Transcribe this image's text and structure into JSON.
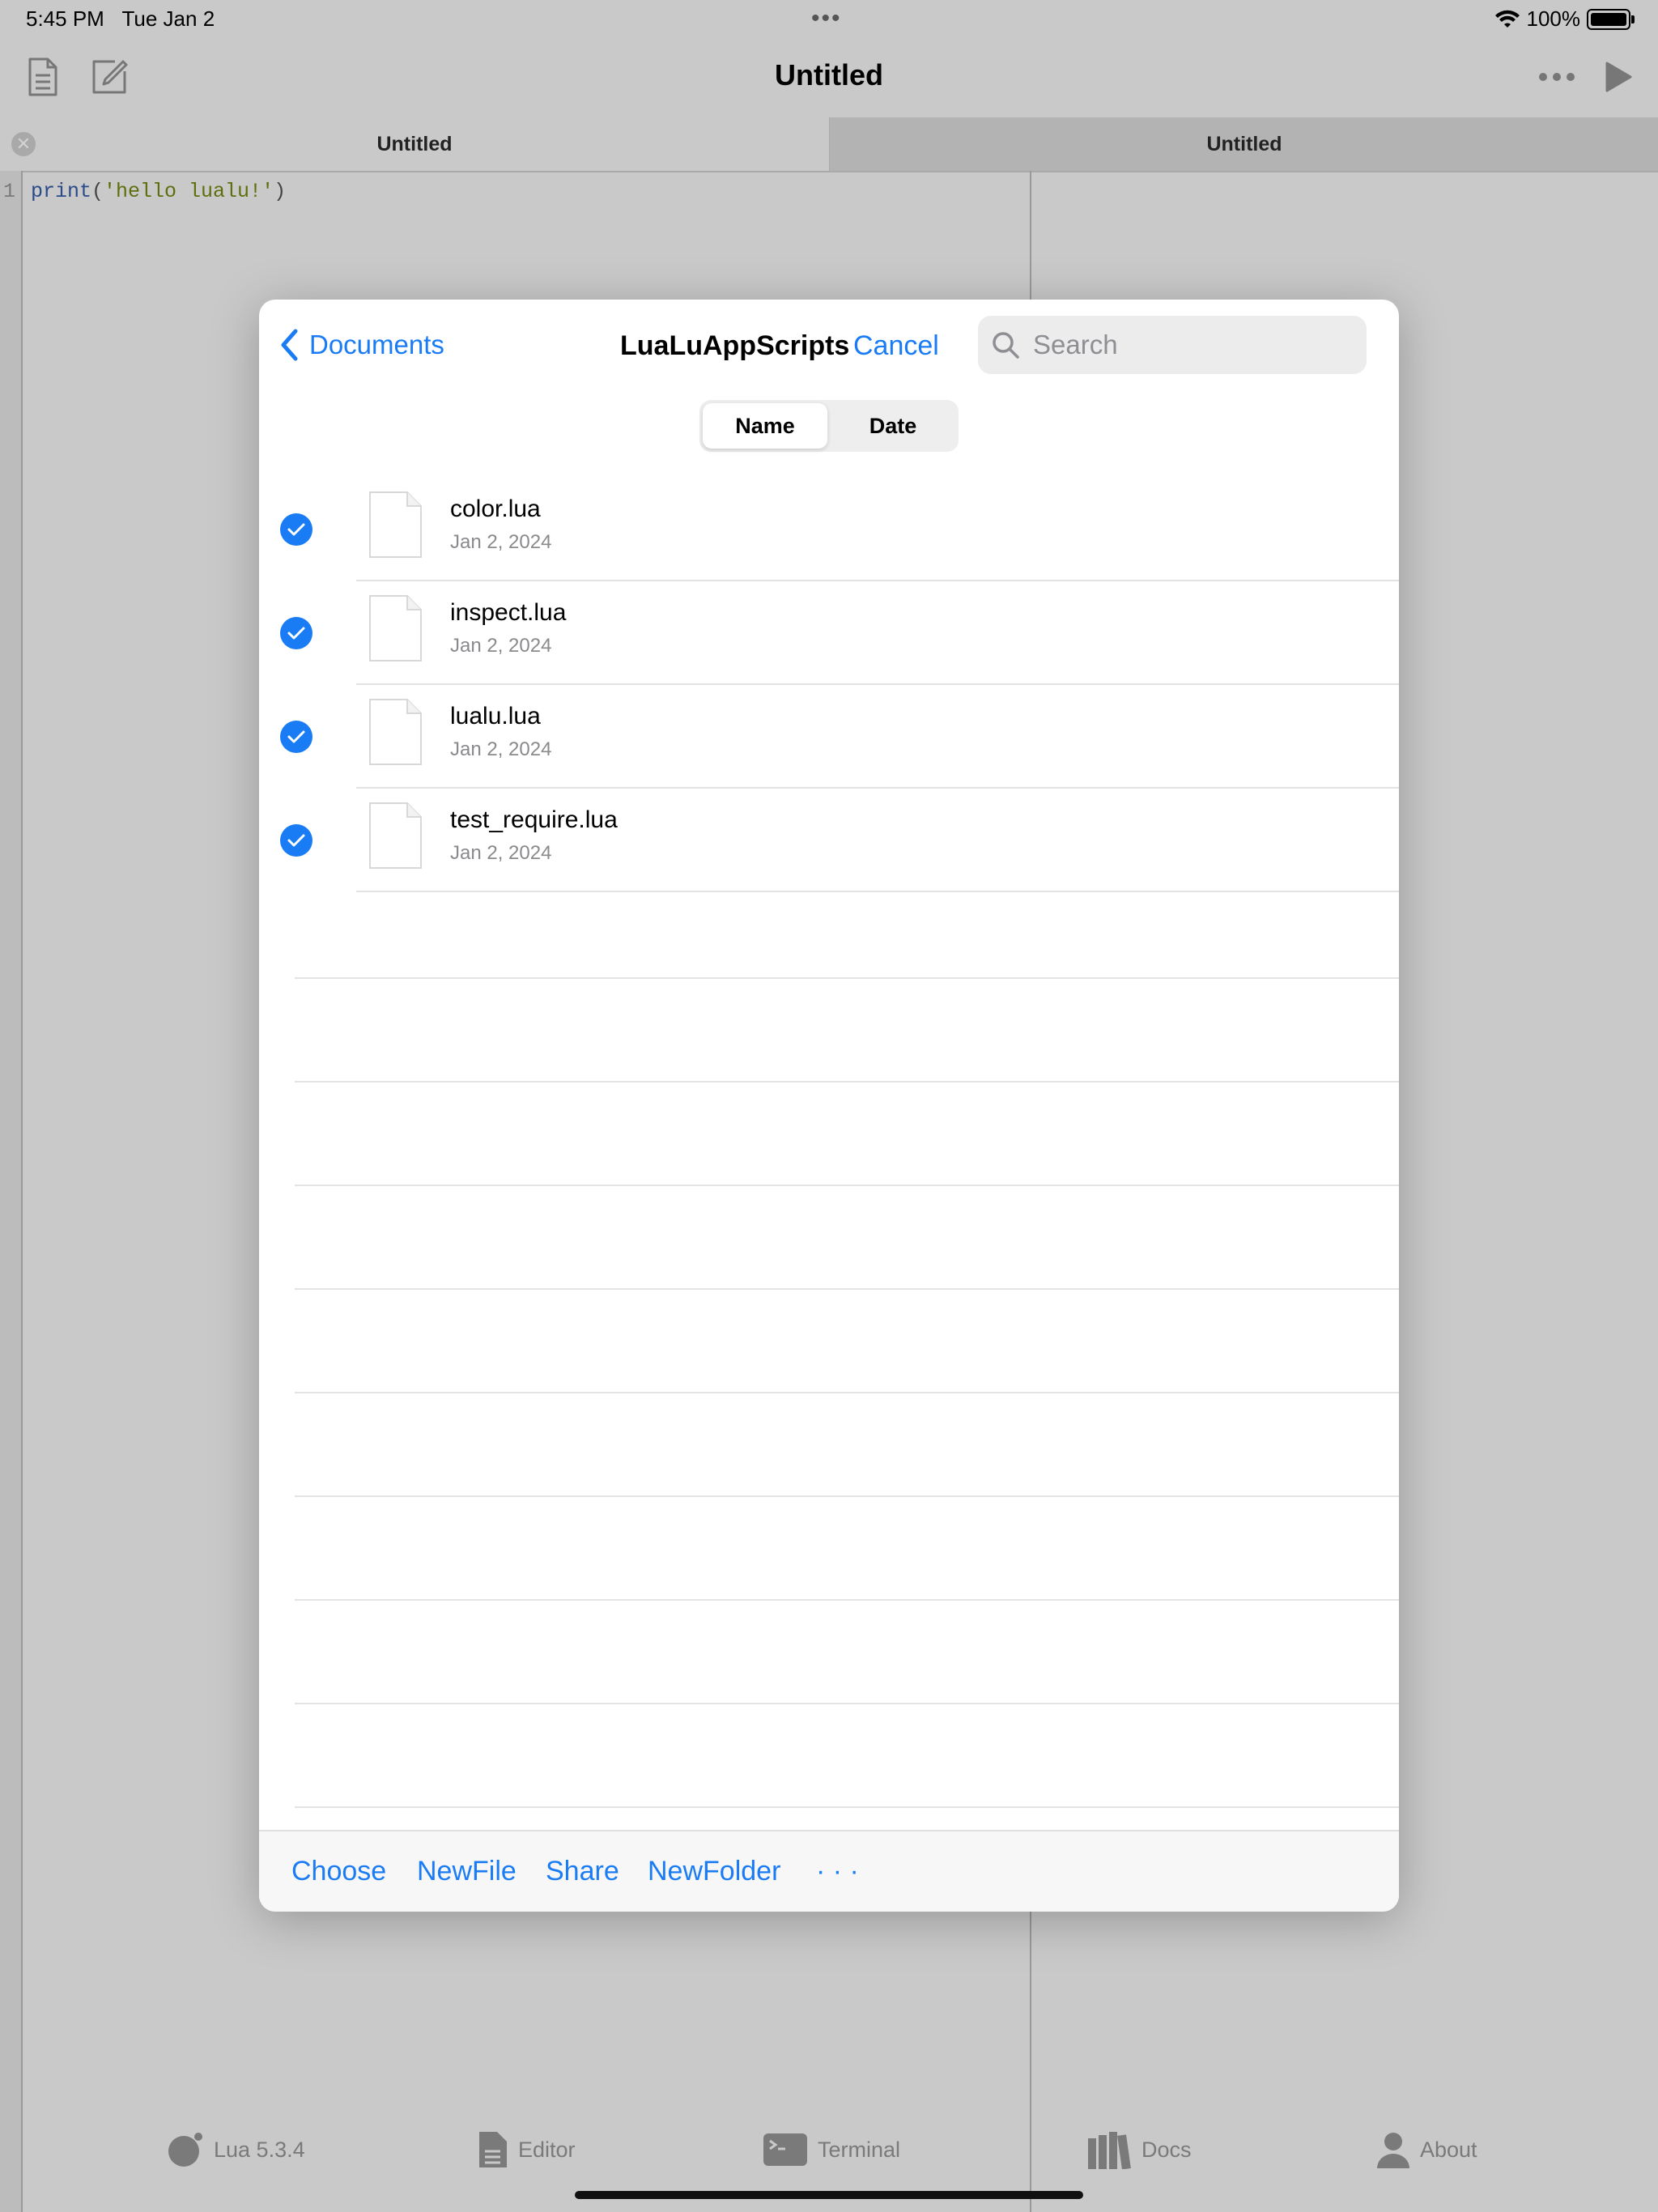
{
  "status": {
    "time": "5:45 PM",
    "date": "Tue Jan 2",
    "more": "•••",
    "battery": "100%"
  },
  "nav": {
    "title": "Untitled"
  },
  "tabs": [
    {
      "label": "Untitled"
    },
    {
      "label": "Untitled"
    }
  ],
  "editor": {
    "line_number": "1",
    "code_fn": "print",
    "code_open": "(",
    "code_str": "'hello lualu!'",
    "code_close": ")"
  },
  "dialog": {
    "back_label": "Documents",
    "title": "LuaLuAppScripts",
    "cancel_label": "Cancel",
    "search_placeholder": "Search",
    "sort": {
      "name": "Name",
      "date": "Date",
      "selected": "Name"
    },
    "files": [
      {
        "name": "color.lua",
        "date": "Jan 2, 2024",
        "selected": true
      },
      {
        "name": "inspect.lua",
        "date": "Jan 2, 2024",
        "selected": true
      },
      {
        "name": "lualu.lua",
        "date": "Jan 2, 2024",
        "selected": true
      },
      {
        "name": "test_require.lua",
        "date": "Jan 2, 2024",
        "selected": true
      }
    ],
    "toolbar": {
      "choose": "Choose",
      "new_file": "NewFile",
      "share": "Share",
      "new_folder": "NewFolder",
      "more": "· · ·"
    },
    "accent_color": "#1a7cf5"
  },
  "bottom_tabs": [
    {
      "label": "Lua 5.3.4",
      "icon": "lua-logo-icon"
    },
    {
      "label": "Editor",
      "icon": "document-icon"
    },
    {
      "label": "Terminal",
      "icon": "terminal-icon"
    },
    {
      "label": "Docs",
      "icon": "books-icon"
    },
    {
      "label": "About",
      "icon": "person-icon"
    }
  ]
}
